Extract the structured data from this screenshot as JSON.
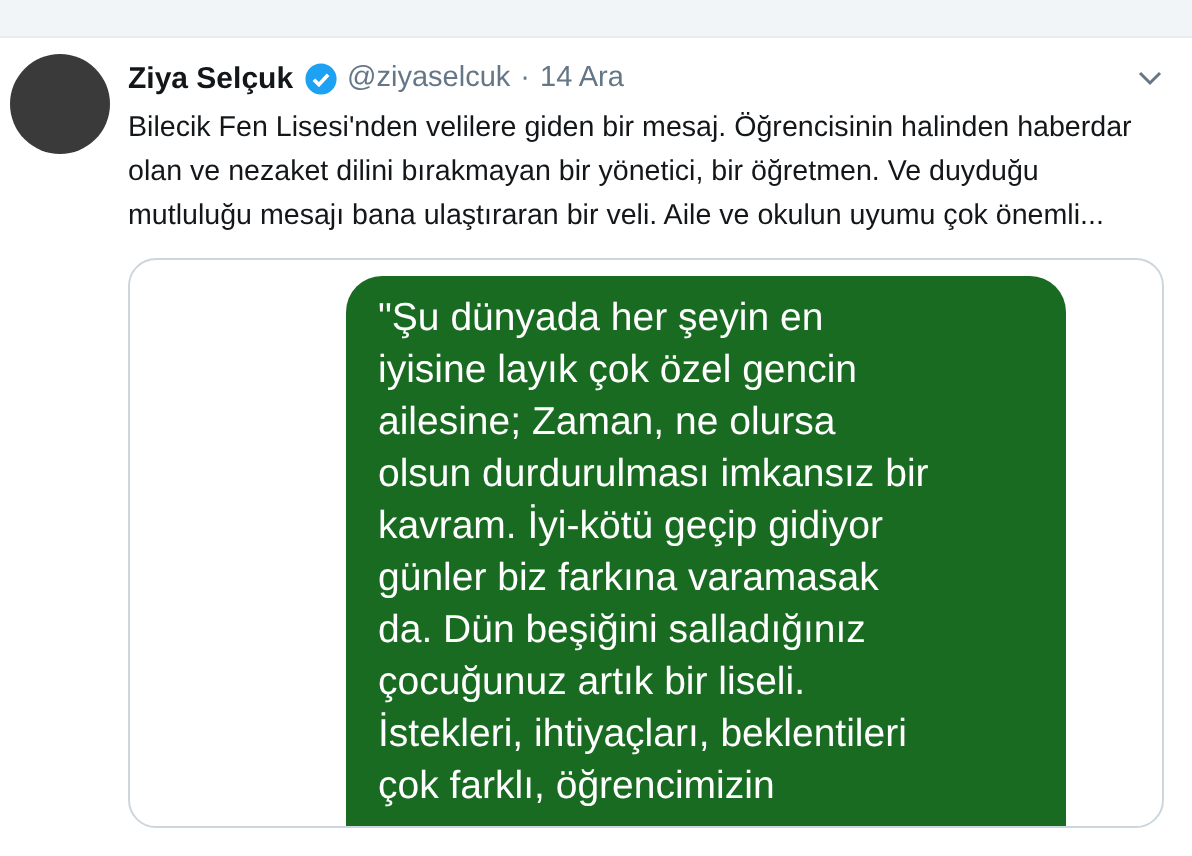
{
  "tweet": {
    "name": "Ziya Selçuk",
    "verified": true,
    "handle": "@ziyaselcuk",
    "separator": "·",
    "date": "14 Ara",
    "text": "Bilecik Fen Lisesi'nden velilere giden bir mesaj. Öğrencisinin halinden haberdar olan ve nezaket dilini bırakmayan bir yönetici, bir öğretmen. Ve duyduğu mutluluğu mesajı bana ulaştıraran bir veli. Aile ve okulun uyumu çok önemli...",
    "image": {
      "message_lines": [
        "\"Şu dünyada her şeyin en",
        "iyisine layık çok özel gencin",
        "ailesine; Zaman, ne olursa",
        "olsun durdurulması imkansız bir",
        "kavram. İyi-kötü geçip gidiyor",
        "günler biz farkına varamasak",
        "da. Dün beşiğini salladığınız",
        "çocuğunuz artık bir liseli.",
        "İstekleri, ihtiyaçları, beklentileri",
        "çok farklı, öğrencimizin"
      ]
    }
  }
}
